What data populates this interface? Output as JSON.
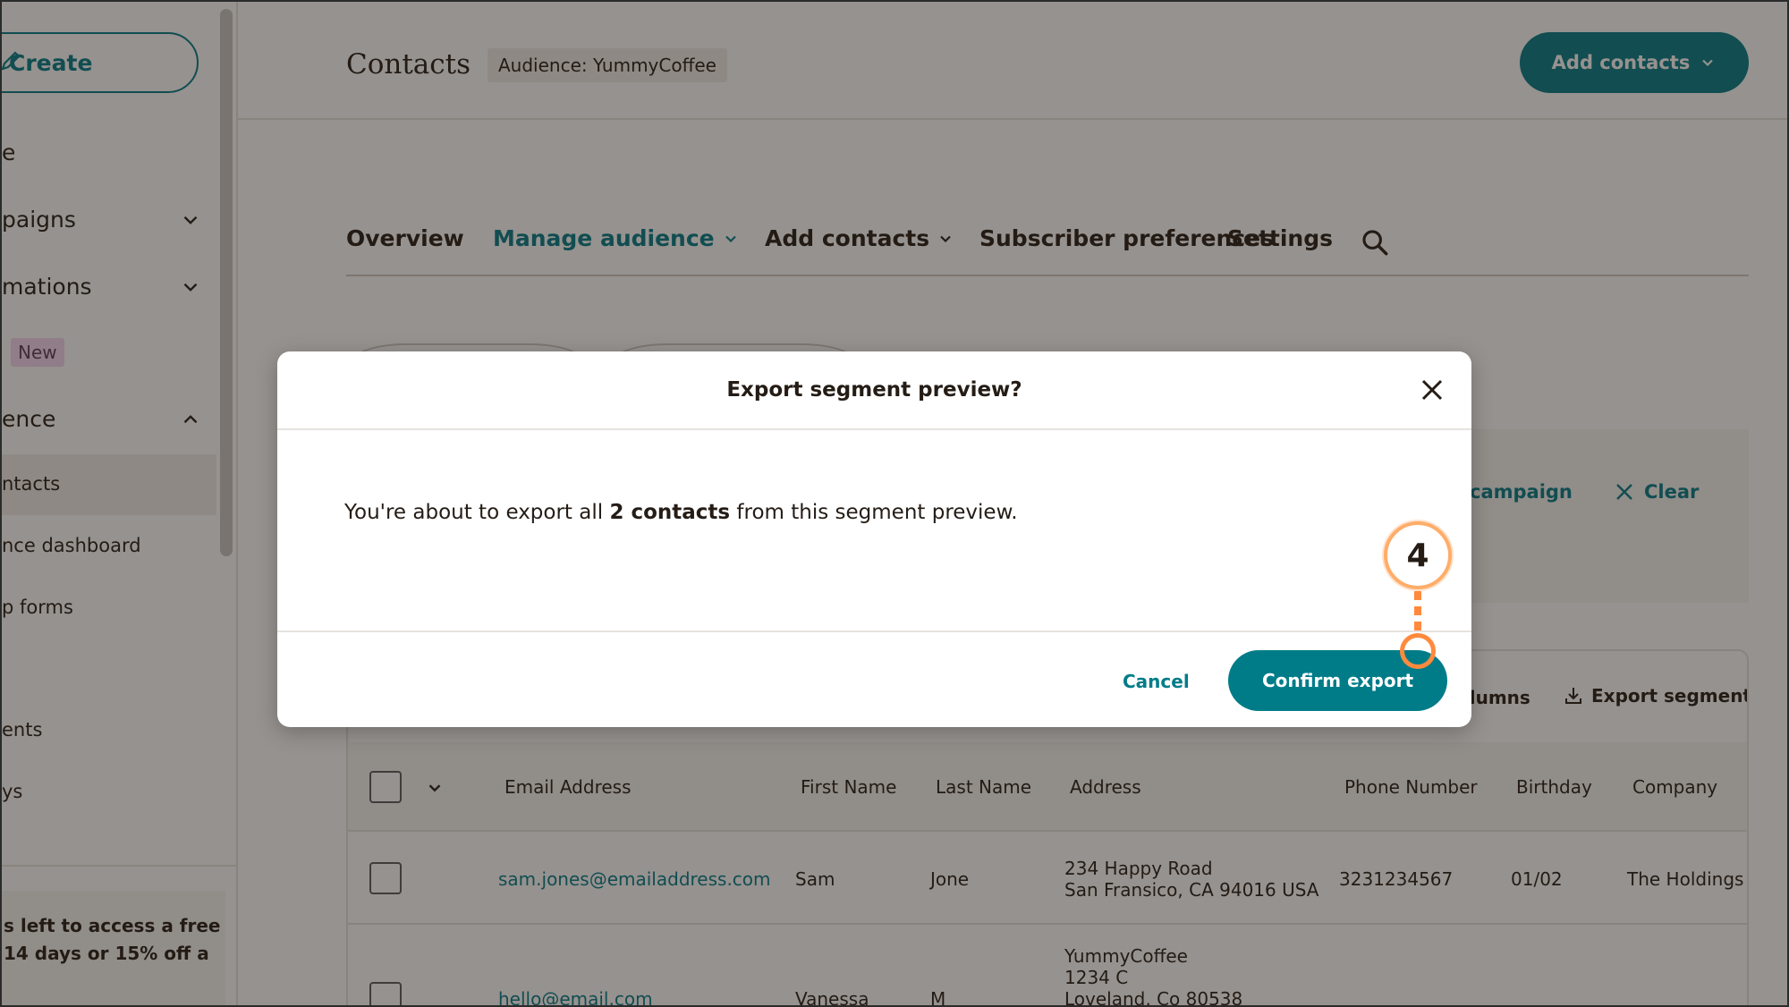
{
  "sidebar": {
    "create_label": "Create",
    "items": [
      {
        "label": "e",
        "chevron": "none"
      },
      {
        "label": "paigns",
        "chevron": "down"
      },
      {
        "label": "mations",
        "chevron": "down"
      },
      {
        "label": "New"
      },
      {
        "label": "ence",
        "chevron": "up"
      }
    ],
    "sub_items": [
      "ntacts",
      "nce dashboard",
      "p forms",
      "ents",
      "ys"
    ],
    "promo_text": "s left to access a free 14 days or 15% off a"
  },
  "header": {
    "title": "Contacts",
    "audience_badge": "Audience: YummyCoffee",
    "add_contacts_label": "Add contacts"
  },
  "tabs": [
    "Overview",
    "Manage audience",
    "Add contacts",
    "Subscriber preferences",
    "Settings"
  ],
  "segment_panel": {
    "campaign_label": "campaign",
    "clear_label": "Clear"
  },
  "table": {
    "tools": {
      "columns_label": "olumns",
      "export_label": "Export segment"
    },
    "headers": [
      "Email Address",
      "First Name",
      "Last Name",
      "Address",
      "Phone Number",
      "Birthday",
      "Company"
    ],
    "rows": [
      {
        "email": "sam.jones@emailaddress.com",
        "first": "Sam",
        "last": "Jone",
        "address_line1": "234 Happy Road",
        "address_line2": "San Fransico, CA 94016 USA",
        "phone": "3231234567",
        "birthday": "01/02",
        "company": "The Holdings C"
      },
      {
        "email": "hello@email.com",
        "first": "Vanessa",
        "last": "M",
        "address_line1": "YummyCoffee",
        "address_line2": "1234 C",
        "address_line3": "Loveland, Co 80538"
      }
    ]
  },
  "modal": {
    "title": "Export segment preview?",
    "body_prefix": "You're about to export all ",
    "body_bold": "2 contacts",
    "body_suffix": " from this segment preview.",
    "cancel_label": "Cancel",
    "confirm_label": "Confirm export"
  },
  "annotation": {
    "step_number": "4"
  },
  "colors": {
    "accent": "#007c89",
    "annotation": "#ff8a3d",
    "new_badge": "#f4d7f3",
    "text": "#241c15"
  },
  "icons": [
    "pencil-icon",
    "chevron-down-icon",
    "chevron-up-icon",
    "search-icon",
    "close-icon",
    "download-icon"
  ]
}
